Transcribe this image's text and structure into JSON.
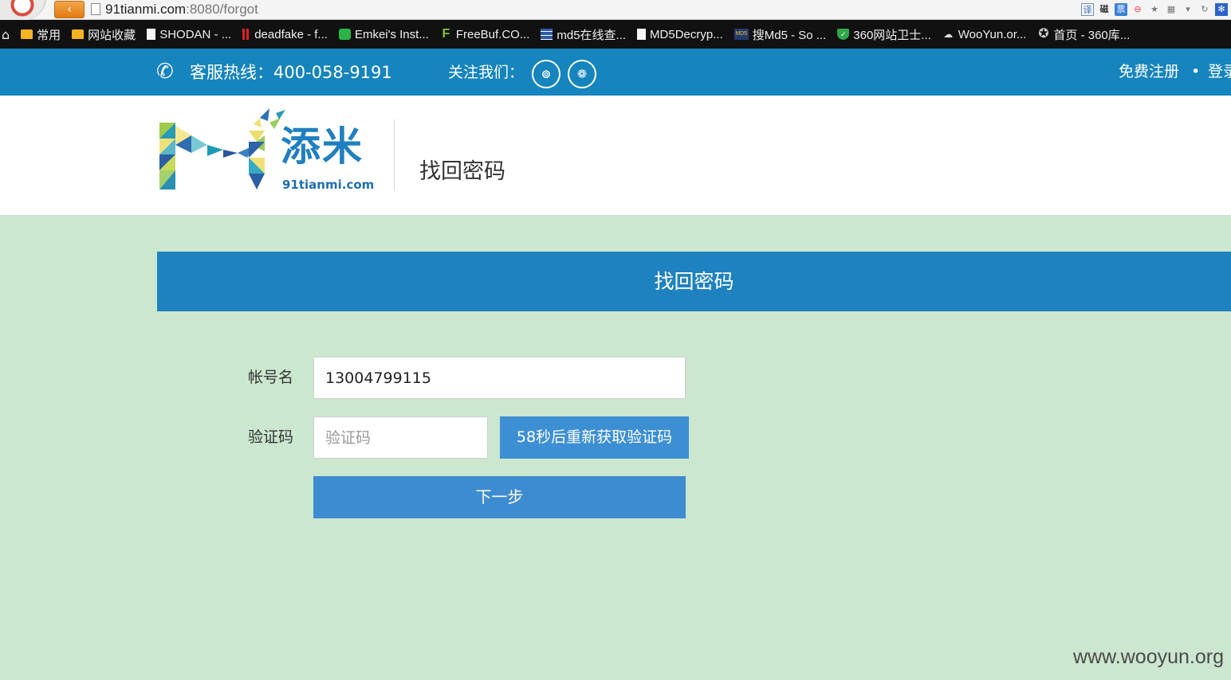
{
  "browser": {
    "url_host": "91tianmi.com",
    "url_rest": ":8080/forgot",
    "toolbar_icons": {
      "translate": "译",
      "magnet": "磁",
      "ticket": "票"
    },
    "bookmarks": [
      {
        "label": "常用",
        "icon": "folder-icon"
      },
      {
        "label": "网站收藏",
        "icon": "folder-icon"
      },
      {
        "label": "SHODAN - ...",
        "icon": "file-icon"
      },
      {
        "label": "deadfake - f...",
        "icon": "red-bars-icon"
      },
      {
        "label": "Emkei's Inst...",
        "icon": "green-app-icon"
      },
      {
        "label": "FreeBuf.CO...",
        "icon": "freebuf-icon"
      },
      {
        "label": "md5在线查...",
        "icon": "grid-icon"
      },
      {
        "label": "MD5Decryp...",
        "icon": "file-icon"
      },
      {
        "label": "搜Md5 - So ...",
        "icon": "md5-icon"
      },
      {
        "label": "360网站卫士...",
        "icon": "shield-icon"
      },
      {
        "label": "WooYun.or...",
        "icon": "cloud-icon"
      },
      {
        "label": "首页 - 360库...",
        "icon": "star-icon"
      }
    ]
  },
  "topbar": {
    "hotline": "客服热线：400-058-9191",
    "follow": "关注我们：",
    "register": "免费注册",
    "separator": "•",
    "login": "登录"
  },
  "header": {
    "logo_text": "添米",
    "logo_url": "91tianmi.com",
    "title": "找回密码"
  },
  "form": {
    "panel_title": "找回密码",
    "account_label": "帐号名",
    "account_value": "13004799115",
    "code_label": "验证码",
    "code_placeholder": "验证码",
    "resend_button": "58秒后重新获取验证码",
    "next_button": "下一步"
  },
  "watermark": "www.wooyun.org",
  "colors": {
    "topbar_blue": "#1684bd",
    "panel_blue": "#1f82c0",
    "button_blue": "#3e8cd0",
    "page_green": "#cbe7cf"
  }
}
